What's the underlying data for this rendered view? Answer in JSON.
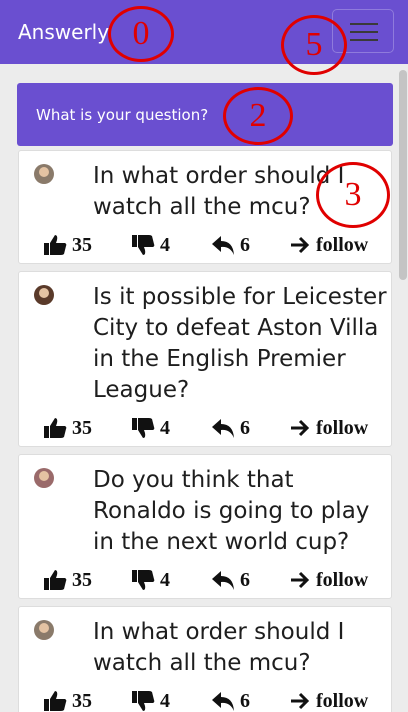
{
  "navbar": {
    "brand": "Answerly",
    "menu_icon": "hamburger-icon"
  },
  "ask": {
    "placeholder": "What is your question?"
  },
  "annotations": [
    "0",
    "5",
    "2",
    "3"
  ],
  "questions": [
    {
      "text": "In what order should I watch all the mcu?",
      "likes": "35",
      "dislikes": "4",
      "replies": "6",
      "follow": "follow",
      "avatar_color": "#6b8f5a"
    },
    {
      "text": "Is it possible for Leicester City to defeat Aston Villa in the English Premier League?",
      "likes": "35",
      "dislikes": "4",
      "replies": "6",
      "follow": "follow",
      "avatar_color": "#5a3a2a"
    },
    {
      "text": "Do you think that Ronaldo is going to play in the next world cup?",
      "likes": "35",
      "dislikes": "4",
      "replies": "6",
      "follow": "follow",
      "avatar_color": "#9a6a6a"
    },
    {
      "text": "In what order should I watch all the mcu?",
      "likes": "35",
      "dislikes": "4",
      "replies": "6",
      "follow": "follow",
      "avatar_color": "#6b8f5a"
    }
  ],
  "colors": {
    "primary": "#6a4fd0",
    "annotation": "#e00000",
    "background": "#ececec"
  }
}
